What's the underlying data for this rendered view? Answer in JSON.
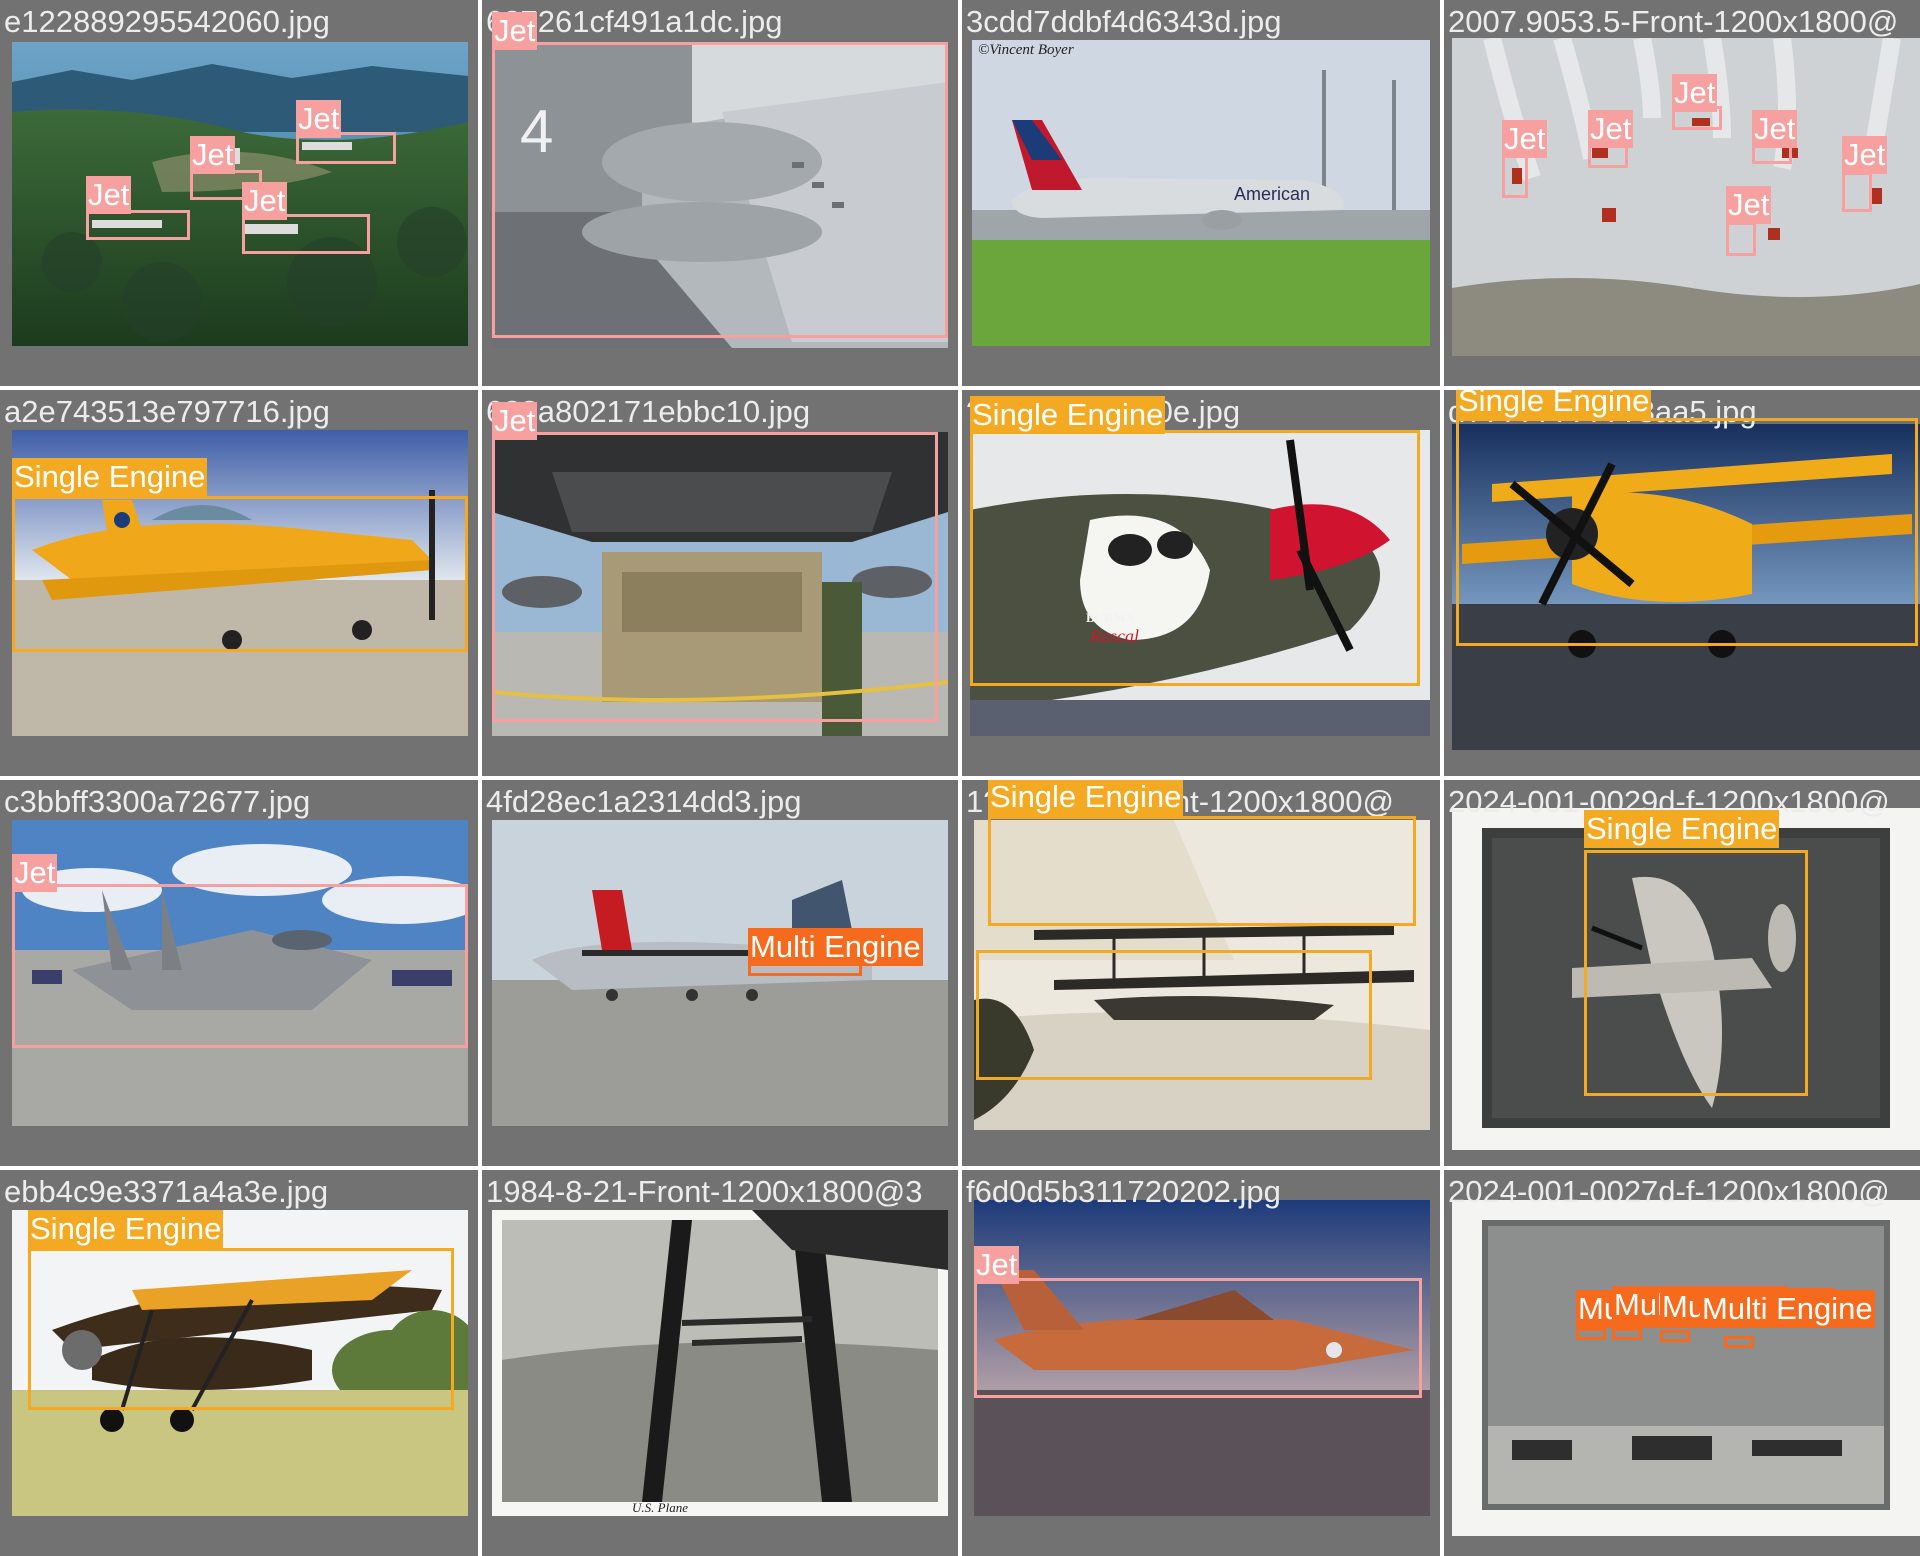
{
  "title": "",
  "colors": {
    "jet": "#f6a0a0",
    "single_engine": "#f4a922",
    "multi_engine": "#f56a1c",
    "tile_background": "#727272",
    "filename_text": "#ececec"
  },
  "classes": {
    "jet": "Jet",
    "single_engine": "Single Engine",
    "multi_engine": "Multi Engine"
  },
  "tiles": [
    {
      "filename": "e122889295542060.jpg",
      "labels": [
        "Jet",
        "Jet",
        "Jet",
        "Jet"
      ]
    },
    {
      "filename": "6?7261cf491a1dc.jpg",
      "labels": [
        "Jet"
      ]
    },
    {
      "filename": "3cdd7ddbf4d6343d.jpg",
      "labels": [],
      "watermark": "©Vincent Boyer",
      "livery_text": "American"
    },
    {
      "filename": "2007.9053.5-Front-1200x1800@",
      "labels": [
        "Jet",
        "Jet",
        "Jet",
        "Jet",
        "Jet",
        "Jet"
      ]
    },
    {
      "filename": "a2e743513e797716.jpg",
      "labels": [
        "Single Engine"
      ]
    },
    {
      "filename": "6??a802171ebbc10.jpg",
      "labels": [
        "Jet"
      ]
    },
    {
      "filename": "?????????1e0e.jpg",
      "labels": [
        "Single Engine"
      ],
      "nose_art": [
        "BURMA",
        "Rascal"
      ]
    },
    {
      "filename": "d??????????8aa5.jpg",
      "labels": [
        "Single Engine"
      ]
    },
    {
      "filename": "c3bbff3300a72677.jpg",
      "labels": [
        "Jet"
      ]
    },
    {
      "filename": "4fd28ec1a2314dd3.jpg",
      "labels": [
        "Multi Engine"
      ]
    },
    {
      "filename": "1??????????ont-1200x1800@",
      "labels": [
        "Single Engine"
      ]
    },
    {
      "filename": "2024-001-0029d-f-1200x1800@",
      "labels": [
        "Single Engine"
      ]
    },
    {
      "filename": "ebb4c9e3371a4a3e.jpg",
      "labels": [
        "Single Engine"
      ]
    },
    {
      "filename": "1984-8-21-Front-1200x1800@3",
      "labels": [],
      "caption": "U.S. Plane"
    },
    {
      "filename": "f6d0d5b311720202.jpg",
      "labels": [
        "Jet"
      ]
    },
    {
      "filename": "2024-001-0027d-f-1200x1800@",
      "labels": [
        "Multi Engine",
        "Multi Engine",
        "Multi Engine",
        "Multi Engine"
      ]
    }
  ]
}
